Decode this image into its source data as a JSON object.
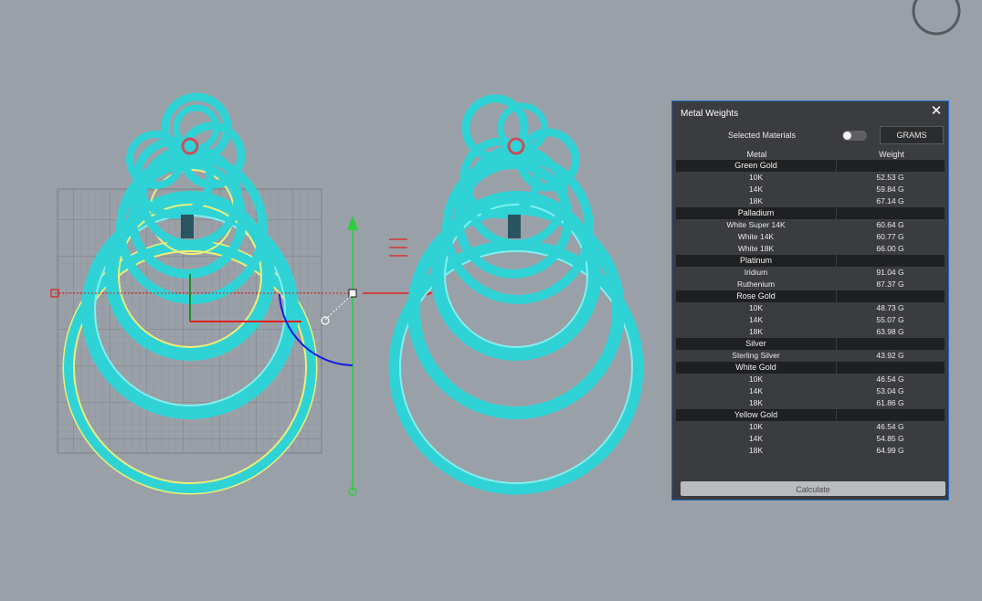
{
  "panel": {
    "title": "Metal Weights",
    "close_icon": "close-icon",
    "selected_materials_label": "Selected Materials",
    "toggle_on": false,
    "units_label": "GRAMS",
    "col_metal": "Metal",
    "col_weight": "Weight",
    "calculate_label": "Calculate"
  },
  "groups": [
    {
      "name": "Green Gold",
      "items": [
        {
          "name": "10K",
          "weight": "52.53 G"
        },
        {
          "name": "14K",
          "weight": "59.84 G"
        },
        {
          "name": "18K",
          "weight": "67.14 G"
        }
      ]
    },
    {
      "name": "Palladium",
      "items": [
        {
          "name": "White Super 14K",
          "weight": "60.64 G"
        },
        {
          "name": "White 14K",
          "weight": "60.77 G"
        },
        {
          "name": "White 18K",
          "weight": "66.00 G"
        }
      ]
    },
    {
      "name": "Platinum",
      "items": [
        {
          "name": "Iridium",
          "weight": "91.04 G"
        },
        {
          "name": "Ruthenium",
          "weight": "87.37 G"
        }
      ]
    },
    {
      "name": "Rose Gold",
      "items": [
        {
          "name": "10K",
          "weight": "48.73 G"
        },
        {
          "name": "14K",
          "weight": "55.07 G"
        },
        {
          "name": "18K",
          "weight": "63.98 G"
        }
      ]
    },
    {
      "name": "Silver",
      "items": [
        {
          "name": "Sterling Silver",
          "weight": "43.92 G"
        }
      ]
    },
    {
      "name": "White Gold",
      "items": [
        {
          "name": "10K",
          "weight": "46.54 G"
        },
        {
          "name": "14K",
          "weight": "53.04 G"
        },
        {
          "name": "18K",
          "weight": "61.86 G"
        }
      ]
    },
    {
      "name": "Yellow Gold",
      "items": [
        {
          "name": "10K",
          "weight": "46.54 G"
        },
        {
          "name": "14K",
          "weight": "54.85 G"
        },
        {
          "name": "18K",
          "weight": "64.99 G"
        }
      ]
    }
  ],
  "colors": {
    "viewport_bg": "#9aa0a8",
    "ring_cyan": "#2fd3d6",
    "ring_yellow": "#e8f07a",
    "panel_border": "#1e6fc8",
    "gizmo_green": "#2ecc40",
    "gizmo_red": "#e02020",
    "gizmo_blue": "#1020e0"
  }
}
